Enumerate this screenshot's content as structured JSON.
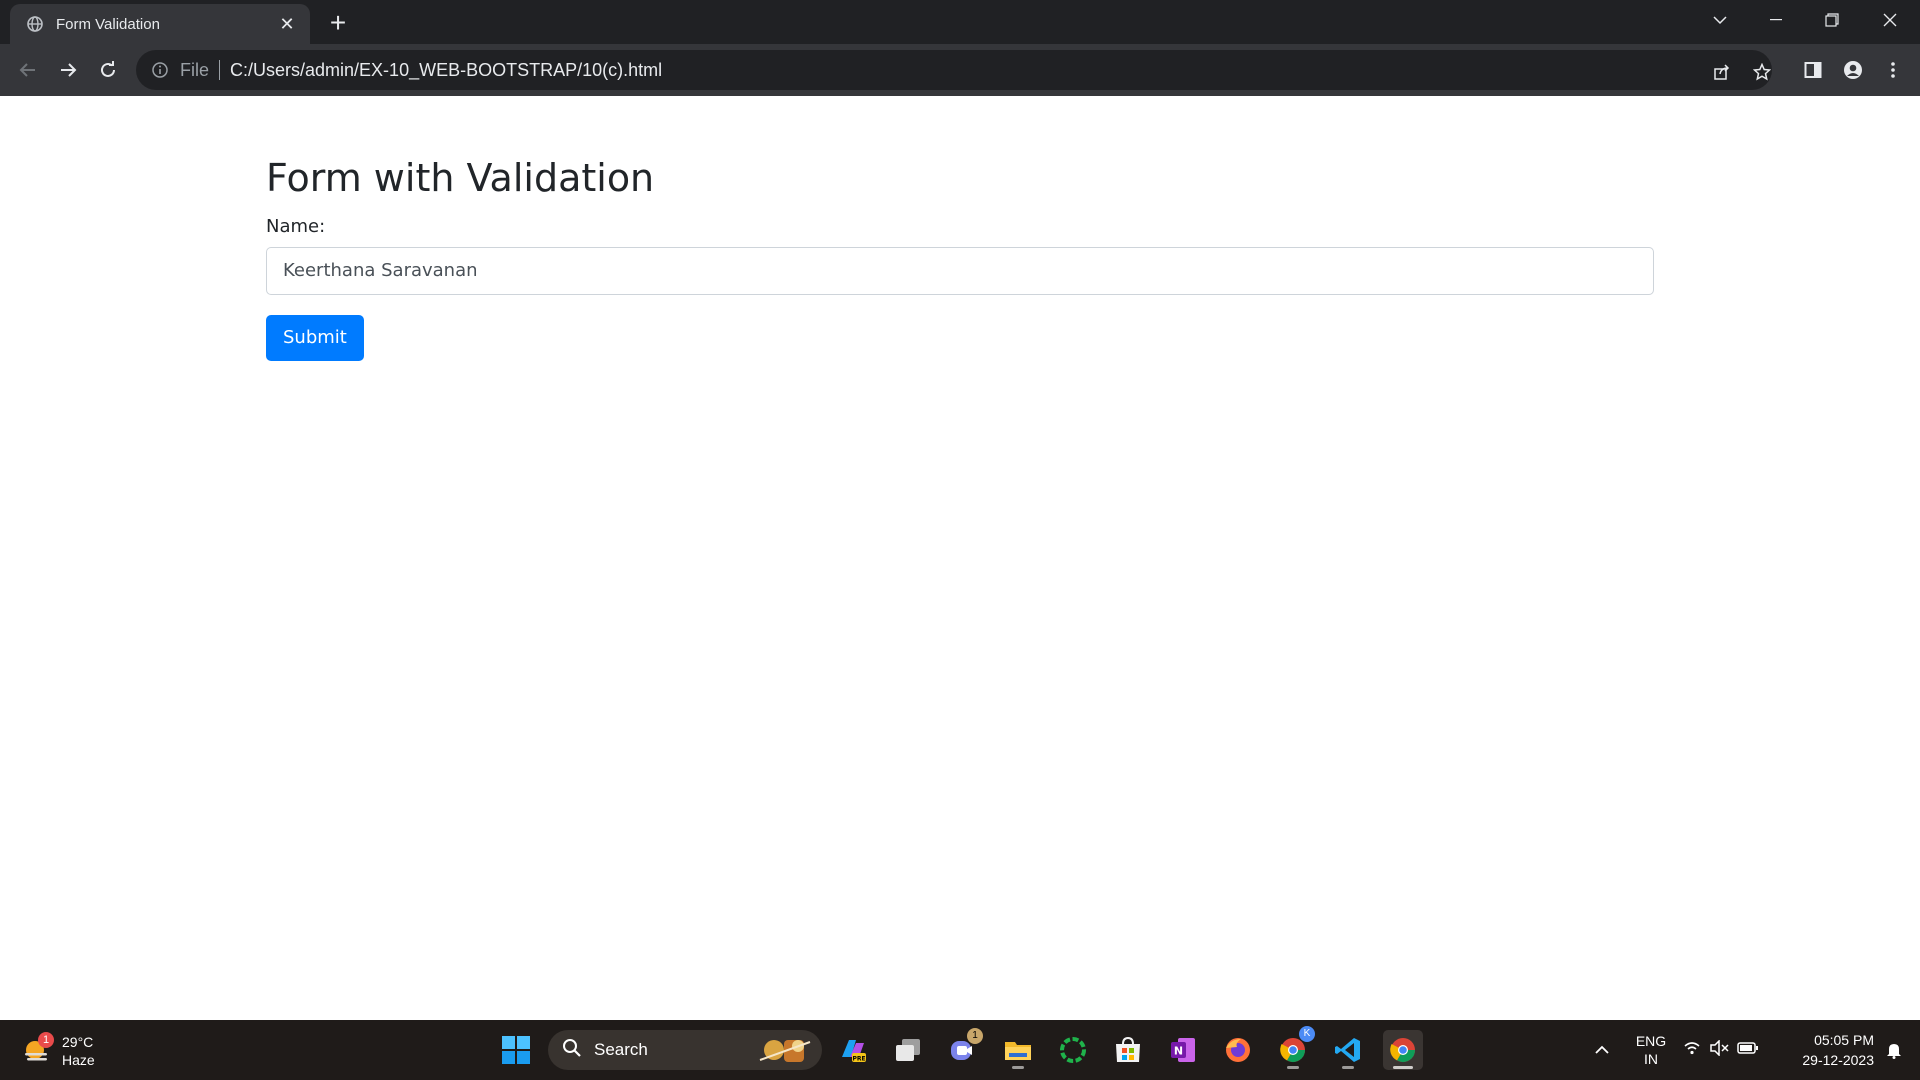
{
  "browser": {
    "tab_title": "Form Validation",
    "omnibox_scheme": "File",
    "omnibox_url": "C:/Users/admin/EX-10_WEB-BOOTSTRAP/10(c).html"
  },
  "page": {
    "title": "Form with Validation",
    "name_label": "Name:",
    "name_value": "Keerthana Saravanan",
    "submit_label": "Submit",
    "colors": {
      "primary": "#007bff",
      "text": "#212529",
      "border": "#ced4da"
    }
  },
  "taskbar": {
    "weather_temp": "29°C",
    "weather_desc": "Haze",
    "weather_badge": "1",
    "search_label": "Search",
    "teams_badge": "1",
    "chrome_profile_badge": "K",
    "lang_line1": "ENG",
    "lang_line2": "IN",
    "time": "05:05 PM",
    "date": "29-12-2023",
    "pinned_apps": [
      "start",
      "search",
      "copilot",
      "task-view",
      "teams",
      "file-explorer",
      "app-ring",
      "microsoft-store",
      "onenote",
      "firefox",
      "chrome-profile",
      "vscode",
      "chrome"
    ]
  }
}
